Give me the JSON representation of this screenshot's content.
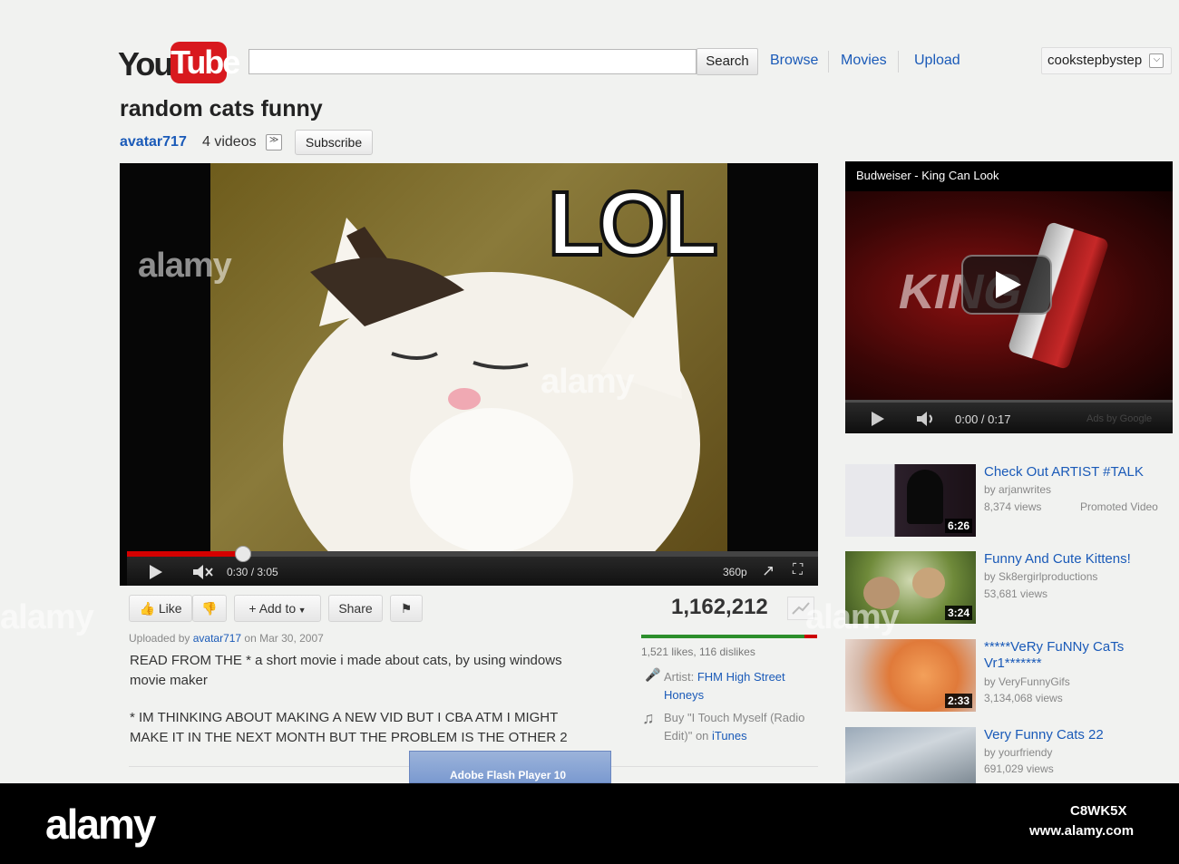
{
  "header": {
    "logo_you": "You",
    "logo_tube": "Tube",
    "search_button": "Search",
    "nav": [
      "Browse",
      "Movies",
      "Upload"
    ],
    "username": "cookstepbystep"
  },
  "video": {
    "title": "random cats funny",
    "channel": "avatar717",
    "video_count": "4 videos",
    "subscribe": "Subscribe",
    "caption": "LOL",
    "time": "0:30 / 3:05",
    "quality": "360p",
    "progress_fraction": 0.167,
    "loaded_fraction": 0.18
  },
  "actions": {
    "like": "Like",
    "add_to": "Add to",
    "share": "Share"
  },
  "stats": {
    "views": "1,162,212",
    "likes_text": "1,521 likes, 116 dislikes",
    "like_fraction": 0.93,
    "artist_label": "Artist: ",
    "artist_name": "FHM High Street",
    "artist_name2": "Honeys",
    "buy_text": "Buy \"I Touch Myself (Radio",
    "buy_text2": "Edit)\" on ",
    "buy_store": "iTunes"
  },
  "description": {
    "uploaded_prefix": "Uploaded by ",
    "uploader": "avatar717",
    "uploaded_date": " on Mar 30, 2007",
    "line1": "READ FROM THE * a short movie i made about cats, by using windows",
    "line2": "movie maker",
    "line3": "* IM THINKING ABOUT MAKING A NEW VID BUT I CBA ATM I MIGHT",
    "line4": "MAKE IT IN THE NEXT MONTH BUT THE PROBLEM IS THE OTHER 2"
  },
  "flash_notice": "Adobe Flash Player 10",
  "ad": {
    "title": "Budweiser - King Can Look",
    "time": "0:00 / 0:17",
    "ads_by": "Ads by Google"
  },
  "related": [
    {
      "title": "Check Out ARTIST #TALK",
      "by": "by arjanwrites",
      "views": "8,374 views",
      "duration": "6:26",
      "tag": "Promoted Video"
    },
    {
      "title": "Funny And Cute Kittens!",
      "by": "by Sk8ergirlproductions",
      "views": "53,681 views",
      "duration": "3:24"
    },
    {
      "title": "*****VeRy FuNNy CaTs Vr1*******",
      "by": "by VeryFunnyGifs",
      "views": "3,134,068 views",
      "duration": "2:33"
    },
    {
      "title": "Very Funny Cats 22",
      "by": "by yourfriendy",
      "views": "691,029 views"
    }
  ],
  "watermark": {
    "brand": "alamy",
    "image_id": "C8WK5X",
    "url": "www.alamy.com"
  },
  "colors": {
    "link": "#1a5ab8",
    "brand_red": "#d8191e",
    "progress_red": "#d40000",
    "like_green": "#2c8f2c"
  }
}
